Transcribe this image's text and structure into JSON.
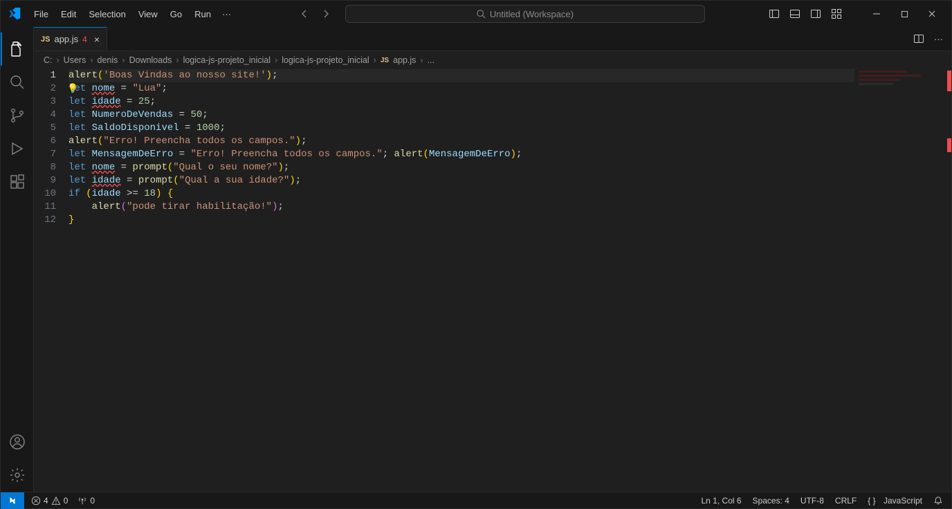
{
  "menu": {
    "file": "File",
    "edit": "Edit",
    "selection": "Selection",
    "view": "View",
    "go": "Go",
    "run": "Run",
    "more": "···"
  },
  "nav": {
    "searchPlaceholder": "Untitled (Workspace)"
  },
  "tab": {
    "icon": "JS",
    "name": "app.js",
    "problems": "4"
  },
  "breadcrumbs": {
    "parts": [
      "C:",
      "Users",
      "denis",
      "Downloads",
      "logica-js-projeto_inicial",
      "logica-js-projeto_inicial"
    ],
    "fileIcon": "JS",
    "file": "app.js",
    "tail": "..."
  },
  "code": {
    "l1": {
      "fn": "alert",
      "lp": "(",
      "str": "'Boas Vindas ao nosso site!'",
      "rp": ")",
      "semi": ";"
    },
    "l2": {
      "kw": "let",
      "sp": " ",
      "var": "nome",
      "eq": " = ",
      "str": "\"Lua\"",
      "semi": ";"
    },
    "l3": {
      "kw": "let",
      "sp": " ",
      "var": "idade",
      "eq": " = ",
      "num": "25",
      "semi": ";"
    },
    "l4": {
      "kw": "let",
      "sp": " ",
      "var": "NumeroDeVendas",
      "eq": " = ",
      "num": "50",
      "semi": ";"
    },
    "l5": {
      "kw": "let",
      "sp": " ",
      "var": "SaldoDisponivel",
      "eq": " = ",
      "num": "1000",
      "semi": ";"
    },
    "l6": {
      "fn": "alert",
      "lp": "(",
      "str": "\"Erro! Preencha todos os campos.\"",
      "rp": ")",
      "semi": ";"
    },
    "l7": {
      "kw": "let",
      "sp": " ",
      "var": "MensagemDeErro",
      "eq": " = ",
      "str": "\"Erro! Preencha todos os campos.\"",
      "semi": "; ",
      "fn": "alert",
      "lp": "(",
      "arg": "MensagemDeErro",
      "rp": ")",
      "semi2": ";"
    },
    "l8": {
      "kw": "let",
      "sp": " ",
      "var": "nome",
      "eq": " = ",
      "fn": "prompt",
      "lp": "(",
      "str": "\"Qual o seu nome?\"",
      "rp": ")",
      "semi": ";"
    },
    "l9": {
      "kw": "let",
      "sp": " ",
      "var": "idade",
      "eq": " = ",
      "fn": "prompt",
      "lp": "(",
      "str": "\"Qual a sua idade?\"",
      "rp": ")",
      "semi": ";"
    },
    "l10": {
      "kw": "if",
      "sp": " ",
      "lp": "(",
      "var": "idade",
      "op": " >= ",
      "num": "18",
      "rp": ")",
      "sp2": " ",
      "lb": "{"
    },
    "l11": {
      "indent": "    ",
      "fn": "alert",
      "lp": "(",
      "str": "\"pode tirar habilitação!\"",
      "rp": ")",
      "semi": ";"
    },
    "l12": {
      "rb": "}"
    }
  },
  "lineNumbers": [
    "1",
    "2",
    "3",
    "4",
    "5",
    "6",
    "7",
    "8",
    "9",
    "10",
    "11",
    "12"
  ],
  "status": {
    "errors": "4",
    "warnings": "0",
    "ports": "0",
    "lncol": "Ln 1, Col 6",
    "spaces": "Spaces: 4",
    "encoding": "UTF-8",
    "eol": "CRLF",
    "lang": "JavaScript"
  }
}
